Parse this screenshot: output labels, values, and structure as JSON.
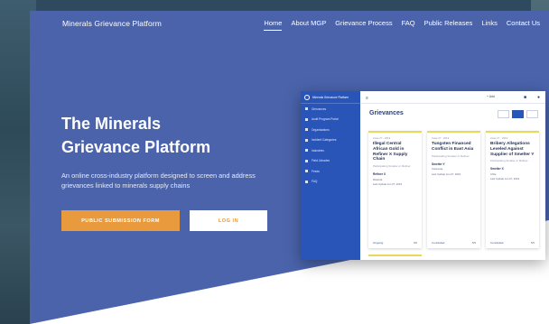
{
  "nav": {
    "brand": "Minerals Grievance Platform",
    "items": [
      "Home",
      "About MGP",
      "Grievance Process",
      "FAQ",
      "Public Releases",
      "Links",
      "Contact Us"
    ]
  },
  "hero": {
    "title_line1": "The Minerals",
    "title_line2": "Grievance Platform",
    "subtitle": "An online cross-industry platform designed to screen and address grievances linked to minerals supply chains",
    "submit_label": "PUBLIC SUBMISSION FORM",
    "login_label": "LOG IN"
  },
  "mockup": {
    "app_name": "Minerals Grievance Platform",
    "sidebar": [
      "Grievances",
      "Audit Program Portal",
      "Organisations",
      "Incident Categories",
      "Industries",
      "Field Libraries",
      "Feeds",
      "FAQ"
    ],
    "add_label": "+ Add",
    "heading": "Grievances",
    "cards": [
      {
        "tag": "Case 27 - 2019",
        "title": "Illegal Central African Gold in Refiner X Supply Chain",
        "meta": "Participating Smelter or Refiner",
        "section": "Refiner X",
        "row1": "Rwanda",
        "row2": "Last Update Jun 27, 2019",
        "status": "Ongoing",
        "count": "3/5"
      },
      {
        "tag": "Case 27 - 2019",
        "title": "Tungsten Financed Conflict in East Asia",
        "meta": "Participating Smelter or Refiner",
        "section": "Smelter Y",
        "row1": "Indonesia",
        "row2": "Last Update Jun 27, 2019",
        "status": "Concluded",
        "count": "5/5"
      },
      {
        "tag": "Case 27 - 2019",
        "title": "Bribery Allegations Leveled Against Supplier of Smelter Y",
        "meta": "Participating Smelter or Refiner",
        "section": "Smelter X",
        "row1": "Chile",
        "row2": "Last Update Jun 27, 2019",
        "status": "Concluded",
        "count": "5/5"
      }
    ]
  },
  "colors": {
    "hero_bg": "#4a63ab",
    "accent_orange": "#e89a3c",
    "app_blue": "#2a55b8",
    "card_accent": "#e7d95a"
  }
}
